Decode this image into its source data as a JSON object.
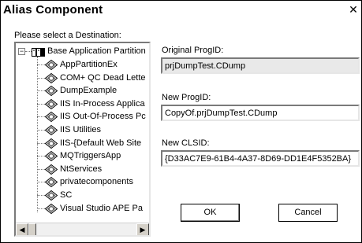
{
  "window": {
    "title": "Alias Component",
    "close_glyph": "✕"
  },
  "prompt": "Please select a Destination:",
  "tree": {
    "root": {
      "label": "Base Application Partition",
      "expander": "−",
      "icon": "folder-icon"
    },
    "children": [
      {
        "label": "AppPartitionEx",
        "icon": "com-app-icon"
      },
      {
        "label": "COM+ QC Dead Lette",
        "icon": "com-app-icon"
      },
      {
        "label": "DumpExample",
        "icon": "com-app-icon"
      },
      {
        "label": "IIS In-Process Applica",
        "icon": "com-app-icon"
      },
      {
        "label": "IIS Out-Of-Process Pc",
        "icon": "com-app-icon"
      },
      {
        "label": "IIS Utilities",
        "icon": "com-app-icon"
      },
      {
        "label": "IIS-{Default Web Site",
        "icon": "com-app-icon"
      },
      {
        "label": "MQTriggersApp",
        "icon": "com-app-icon"
      },
      {
        "label": "NtServices",
        "icon": "com-app-icon"
      },
      {
        "label": "privatecomponents",
        "icon": "com-app-icon"
      },
      {
        "label": "SC",
        "icon": "com-app-icon"
      },
      {
        "label": "Visual Studio APE Pa",
        "icon": "com-app-icon"
      }
    ],
    "scroll_left_glyph": "◀",
    "scroll_right_glyph": "▶"
  },
  "fields": {
    "original_progid": {
      "label": "Original ProgID:",
      "value": "prjDumpTest.CDump"
    },
    "new_progid": {
      "label": "New ProgID:",
      "value": "CopyOf.prjDumpTest.CDump"
    },
    "new_clsid": {
      "label": "New CLSID:",
      "value": "{D33AC7E9-61B4-4A37-8D69-DD1E4F5352BA}"
    }
  },
  "buttons": {
    "ok": "OK",
    "cancel": "Cancel"
  }
}
